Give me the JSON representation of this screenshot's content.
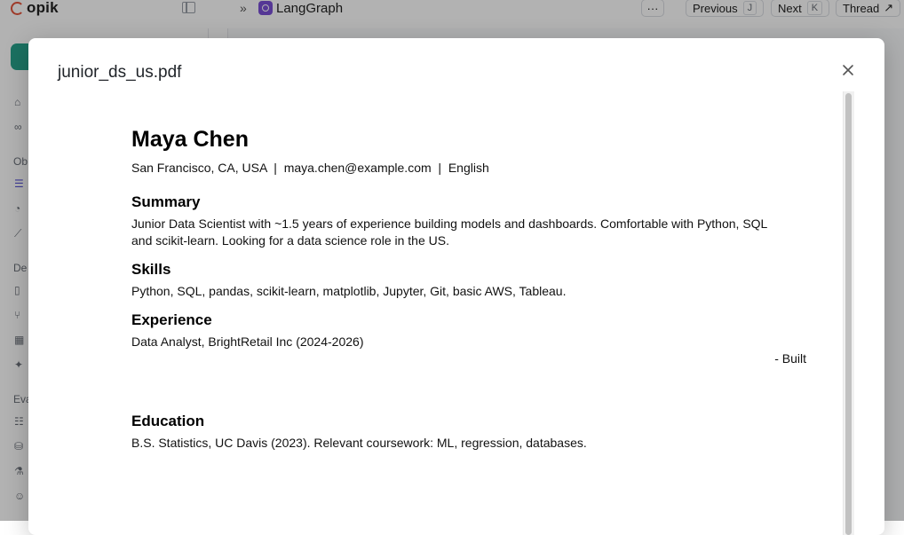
{
  "app": {
    "logo_text": "opik",
    "sidebar": {
      "section_obs": "Ob",
      "section_dev": "De",
      "section_eval": "Eva"
    },
    "topbar": {
      "expand_icon": "chevrons-right-icon",
      "project_name": "LangGraph",
      "more_label": "···",
      "previous_label": "Previous",
      "previous_key": "J",
      "next_label": "Next",
      "next_key": "K",
      "thread_label": "Thread"
    }
  },
  "modal": {
    "title": "junior_ds_us.pdf",
    "close_icon": "close-icon",
    "document": {
      "name": "Maya Chen",
      "contact": "San Francisco, CA, USA  |  maya.chen@example.com  |  English",
      "summary_heading": "Summary",
      "summary_text": "Junior Data Scientist with ~1.5 years of experience building models and dashboards. Comfortable with Python, SQL and scikit-learn. Looking for a data science role in the US.",
      "skills_heading": "Skills",
      "skills_text": "Python, SQL, pandas, scikit-learn, matplotlib, Jupyter, Git, basic AWS, Tableau.",
      "experience_heading": "Experience",
      "experience_text": "Data Analyst, BrightRetail Inc (2024-2026)",
      "experience_bullet": "- Built",
      "education_heading": "Education",
      "education_text": "B.S. Statistics, UC Davis (2023). Relevant coursework: ML, regression, databases."
    }
  },
  "colors": {
    "accent": "#5a55d6",
    "logo": "#e2553d",
    "workspace": "#27a38b",
    "project_icon": "#7a4fd6",
    "overlay": "rgba(0,0,0,0.30)"
  }
}
